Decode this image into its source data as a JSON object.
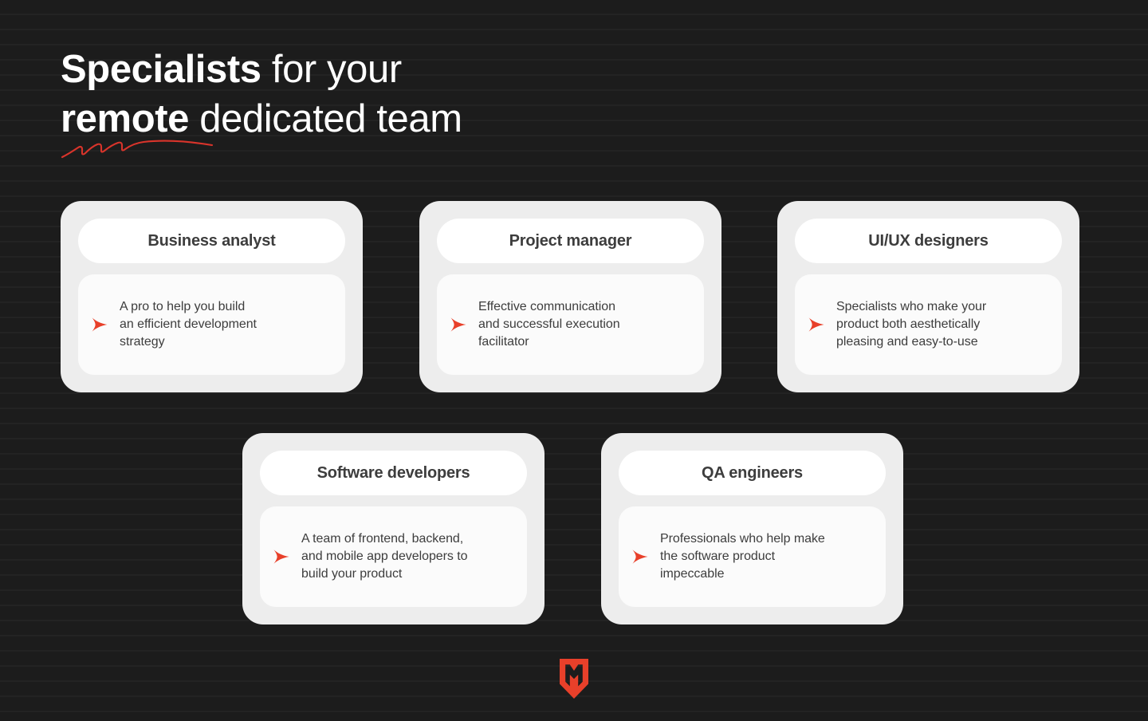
{
  "page": {
    "background_color": "#1c1c1c",
    "accent_color": "#e8402a",
    "card_surface_color": "#ededed",
    "text_color_dark": "#3d3d3d",
    "text_color_light": "#ffffff"
  },
  "heading": {
    "line1_strong": "Specialists",
    "line1_rest": " for your",
    "line2_strong": "remote",
    "line2_rest": " dedicated team",
    "underline_icon": "squiggle-underline-icon"
  },
  "cards": [
    {
      "id": "business-analyst",
      "title": "Business analyst",
      "description": "A pro to help you build\nan efficient development\nstrategy",
      "bullet_icon": "red-arrow-icon"
    },
    {
      "id": "project-manager",
      "title": "Project manager",
      "description": "Effective communication\nand successful execution\nfacilitator",
      "bullet_icon": "red-arrow-icon"
    },
    {
      "id": "ui-ux-designers",
      "title": "UI/UX designers",
      "description": "Specialists who make your\nproduct both aesthetically\npleasing and easy-to-use",
      "bullet_icon": "red-arrow-icon"
    },
    {
      "id": "software-developers",
      "title": "Software developers",
      "description": "A team of frontend, backend,\nand mobile app developers to\nbuild your product",
      "bullet_icon": "red-arrow-icon"
    },
    {
      "id": "qa-engineers",
      "title": "QA engineers",
      "description": "Professionals who help make\nthe software product\nimpeccable",
      "bullet_icon": "red-arrow-icon"
    }
  ],
  "footer": {
    "logo_icon": "shield-monogram-logo-icon",
    "logo_color": "#e8402a"
  }
}
